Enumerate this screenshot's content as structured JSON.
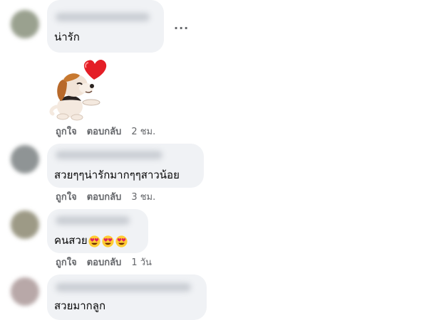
{
  "comments": [
    {
      "text": "น่ารัก",
      "more": "···"
    },
    {
      "sticker_icon": "beagle-heart-sticker",
      "actions": {
        "like": "ถูกใจ",
        "reply": "ตอบกลับ",
        "time": "2 ชม."
      }
    },
    {
      "text": "สวยๆๆน่ารักมากๆๆสาวน้อย",
      "actions": {
        "like": "ถูกใจ",
        "reply": "ตอบกลับ",
        "time": "3 ชม."
      }
    },
    {
      "text": "คนสวย",
      "emoji": [
        "heart-eyes-emoji",
        "heart-eyes-emoji",
        "heart-eyes-emoji"
      ],
      "actions": {
        "like": "ถูกใจ",
        "reply": "ตอบกลับ",
        "time": "1 วัน"
      }
    },
    {
      "text": "สวยมากลูก"
    }
  ],
  "colors": {
    "bubble": "#f0f2f5",
    "action_text": "#65676b",
    "text": "#050505"
  }
}
